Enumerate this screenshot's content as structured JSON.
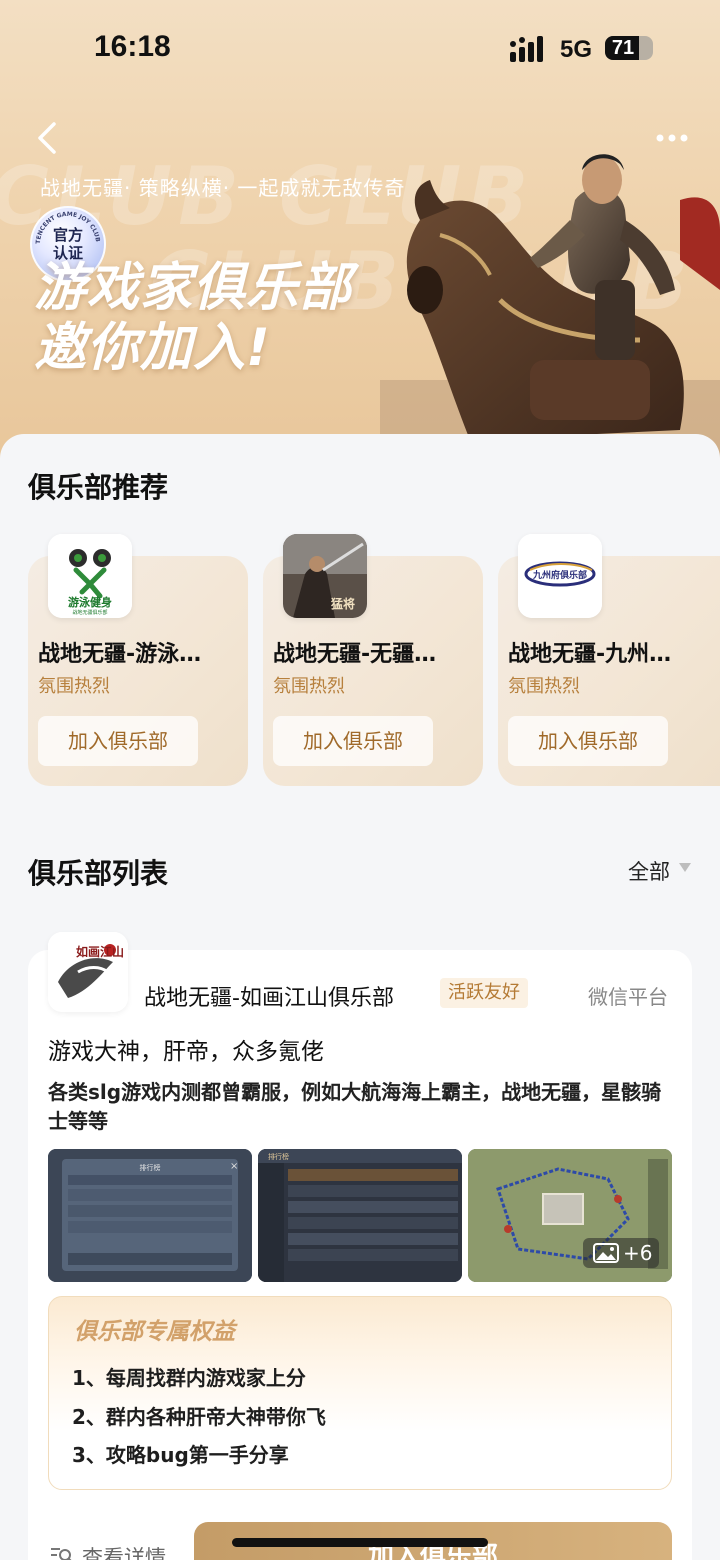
{
  "status_bar": {
    "time": "16:18",
    "network": "5G",
    "battery": "71",
    "battery_level": 0.71
  },
  "hero": {
    "tagline": "战地无疆· 策略纵横· 一起成就无敌传奇",
    "watermark": "CLUB CLUB",
    "badge_line1": "官方",
    "badge_line2": "认证",
    "badge_ring": "TENCENT GAME JOY CLUB",
    "title_line1": "游戏家俱乐部",
    "title_line2": "邀你加入!"
  },
  "recommend": {
    "title": "俱乐部推荐",
    "items": [
      {
        "name": "战地无疆-游泳…",
        "tag": "氛围热烈",
        "join": "加入俱乐部",
        "logo_text": "游泳健身",
        "logo_sub": "战地无疆俱乐部"
      },
      {
        "name": "战地无疆-无疆…",
        "tag": "氛围热烈",
        "join": "加入俱乐部",
        "logo_text": "猛将"
      },
      {
        "name": "战地无疆-九州…",
        "tag": "氛围热烈",
        "join": "加入俱乐部",
        "logo_text": "九州府俱乐部"
      }
    ]
  },
  "club_list": {
    "title": "俱乐部列表",
    "filter": "全部",
    "club": {
      "avatar_text": "如画江山",
      "name": "战地无疆-如画江山俱乐部",
      "tag": "活跃友好",
      "platform": "微信平台",
      "headline": "游戏大神，肝帝，众多氪佬",
      "description": "各类slg游戏内测都曾霸服，例如大航海海上霸主，战地无疆，星骸骑士等等",
      "more_images": "+6",
      "shot1_title": "排行榜",
      "shot2_title": "排行榜",
      "benefits_title": "俱乐部专属权益",
      "benefits": [
        "1、每周找群内游戏家上分",
        "2、群内各种肝帝大神带你飞",
        "3、攻略bug第一手分享"
      ],
      "detail": "查看详情",
      "join": "加入俱乐部"
    }
  },
  "colors": {
    "accent": "#b7803d",
    "join_button": "#c9a06b",
    "hero_bg": "#efd3ad"
  }
}
